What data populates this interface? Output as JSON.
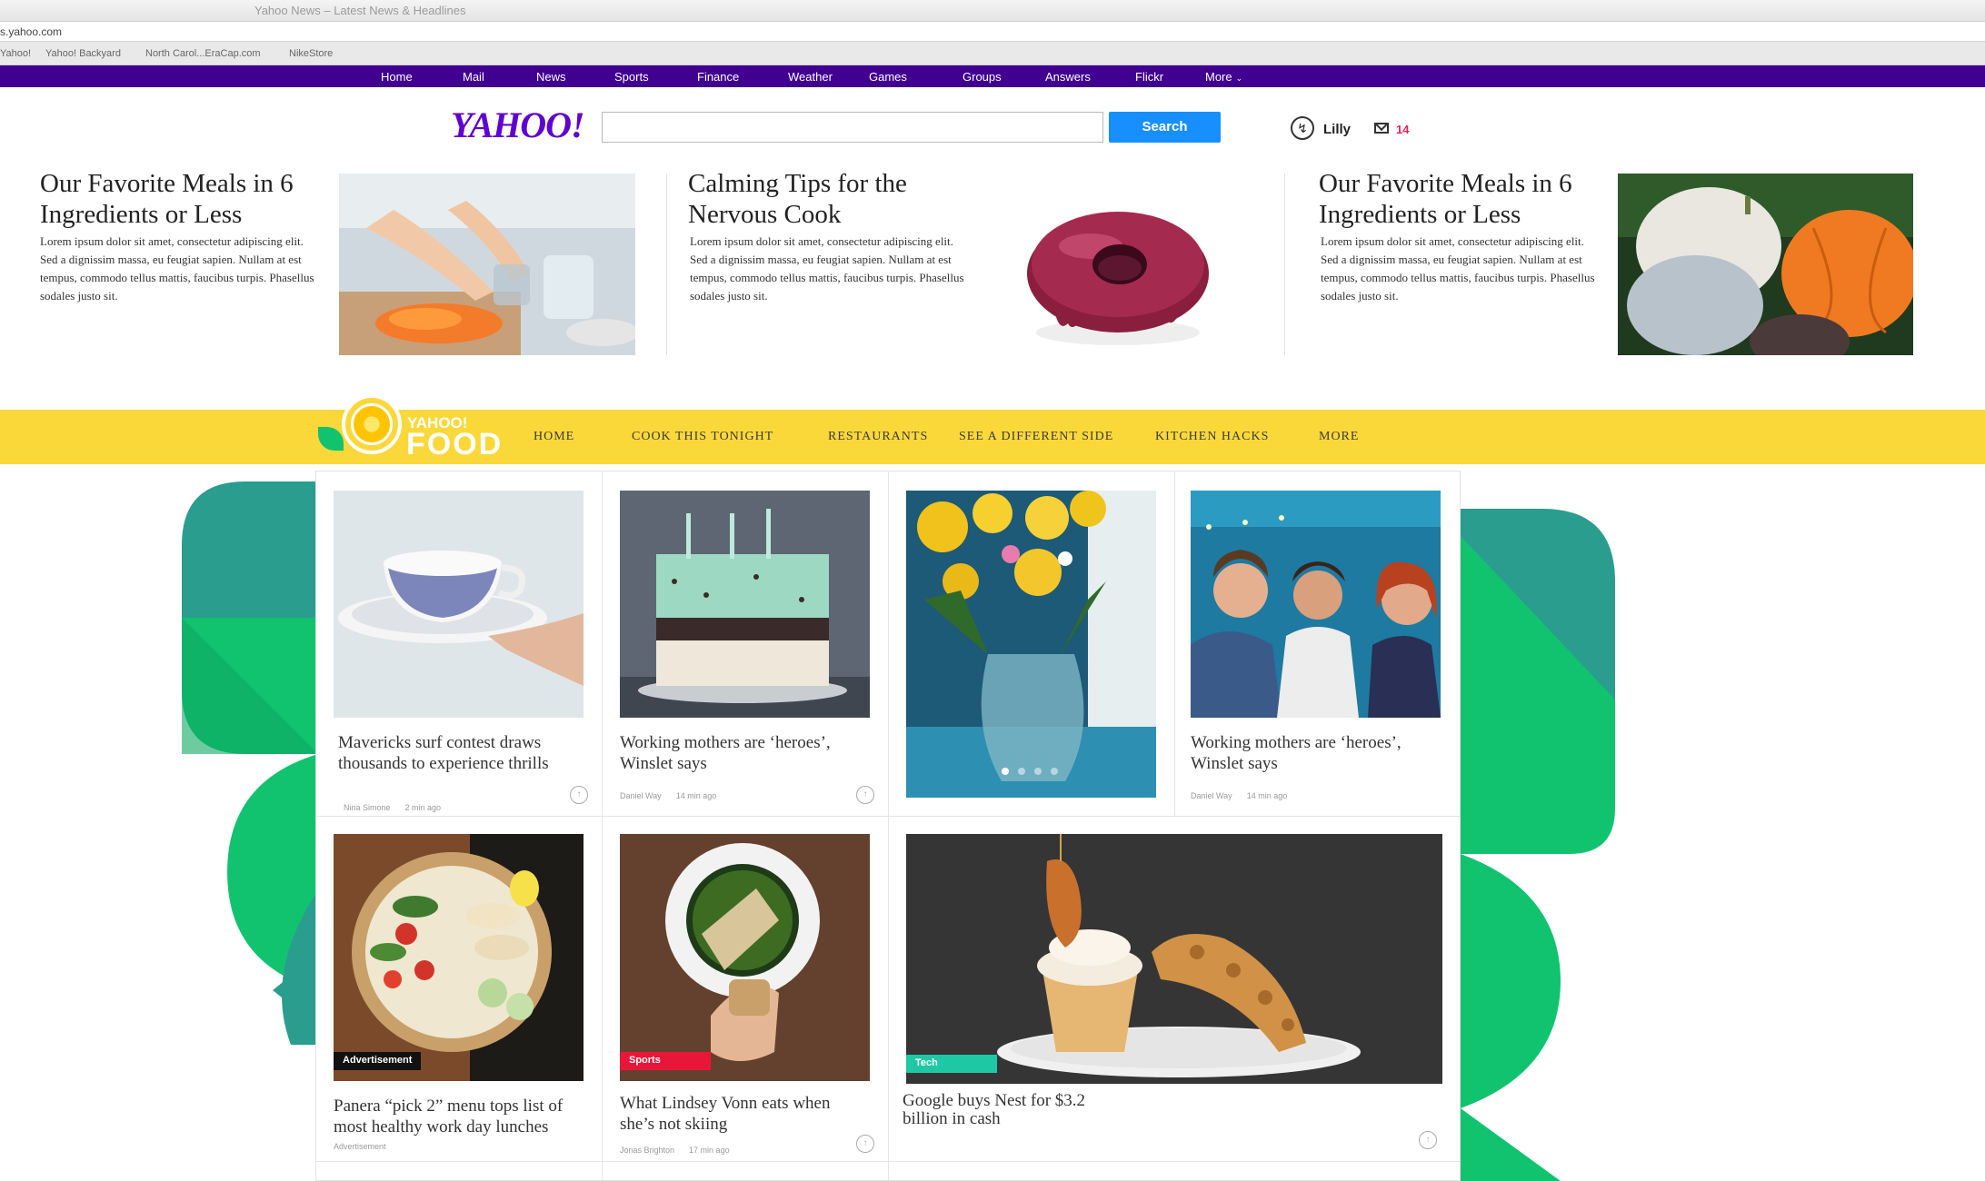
{
  "browser": {
    "window_title": "Yahoo News – Latest News & Headlines",
    "url": "s.yahoo.com",
    "bookmarks": [
      "Yahoo!",
      "Yahoo! Backyard",
      "North Carol...EraCap.com",
      "NikeStore"
    ]
  },
  "topnav": {
    "items": [
      "Home",
      "Mail",
      "News",
      "Sports",
      "Finance",
      "Weather",
      "Games",
      "Groups",
      "Answers",
      "Flickr",
      "More"
    ]
  },
  "header": {
    "logo": "YAHOO!",
    "search_button": "Search",
    "search_value": "",
    "user_name": "Lilly",
    "mail_count": "14"
  },
  "featured": [
    {
      "title": "Our Favorite Meals in 6 Ingredients or Less",
      "body": "Lorem ipsum dolor sit amet, consectetur adipiscing elit. Sed a dignissim massa, eu feugiat sapien. Nullam at est tempus, commodo tellus mattis, faucibus turpis. Phasellus sodales justo sit."
    },
    {
      "title": "Calming Tips for the Nervous Cook",
      "body": "Lorem ipsum dolor sit amet, consectetur adipiscing elit. Sed a dignissim massa, eu feugiat sapien. Nullam at est tempus, commodo tellus mattis, faucibus turpis. Phasellus sodales justo sit."
    },
    {
      "title": "Our Favorite Meals in 6 Ingredients or Less",
      "body": "Lorem ipsum dolor sit amet, consectetur adipiscing elit. Sed a dignissim massa, eu feugiat sapien. Nullam at est tempus, commodo tellus mattis, faucibus turpis. Phasellus sodales justo sit."
    }
  ],
  "food": {
    "logo_small": "YAHOO!",
    "logo_big": "FOOD",
    "nav": [
      "HOME",
      "COOK THIS TONIGHT",
      "RESTAURANTS",
      "SEE A DIFFERENT SIDE",
      "KITCHEN HACKS",
      "MORE"
    ]
  },
  "cards": [
    {
      "title": "Mavericks surf contest draws thousands to experience thrills",
      "author": "Nina Simone",
      "time": "2 min ago"
    },
    {
      "title": "Working mothers are ‘heroes’, Winslet says",
      "author": "Daniel Way",
      "time": "14 min ago"
    },
    {
      "title": "Working mothers are ‘heroes’, Winslet says",
      "author": "Daniel Way",
      "time": "14 min ago"
    },
    {
      "title": "Panera “pick 2” menu tops list of most healthy work day lunches",
      "tag": "Advertisement",
      "meta": "Advertisement"
    },
    {
      "title": "What Lindsey Vonn eats when she’s not skiing",
      "tag": "Sports",
      "author": "Jonas Brighton",
      "time": "17 min ago"
    },
    {
      "title": "Google buys Nest for $3.2 billion in cash",
      "tag": "Tech"
    }
  ],
  "colors": {
    "topnav_bg": "#400090",
    "yahoo_purple": "#5f01d1",
    "search_blue": "#188fff",
    "food_yellow": "#fbd83a",
    "deco_green": "#11c36e",
    "deco_teal": "#2a9d8f",
    "tag_ad": "#111111",
    "tag_sports": "#e8173a",
    "tag_tech": "#1fc8a4"
  }
}
